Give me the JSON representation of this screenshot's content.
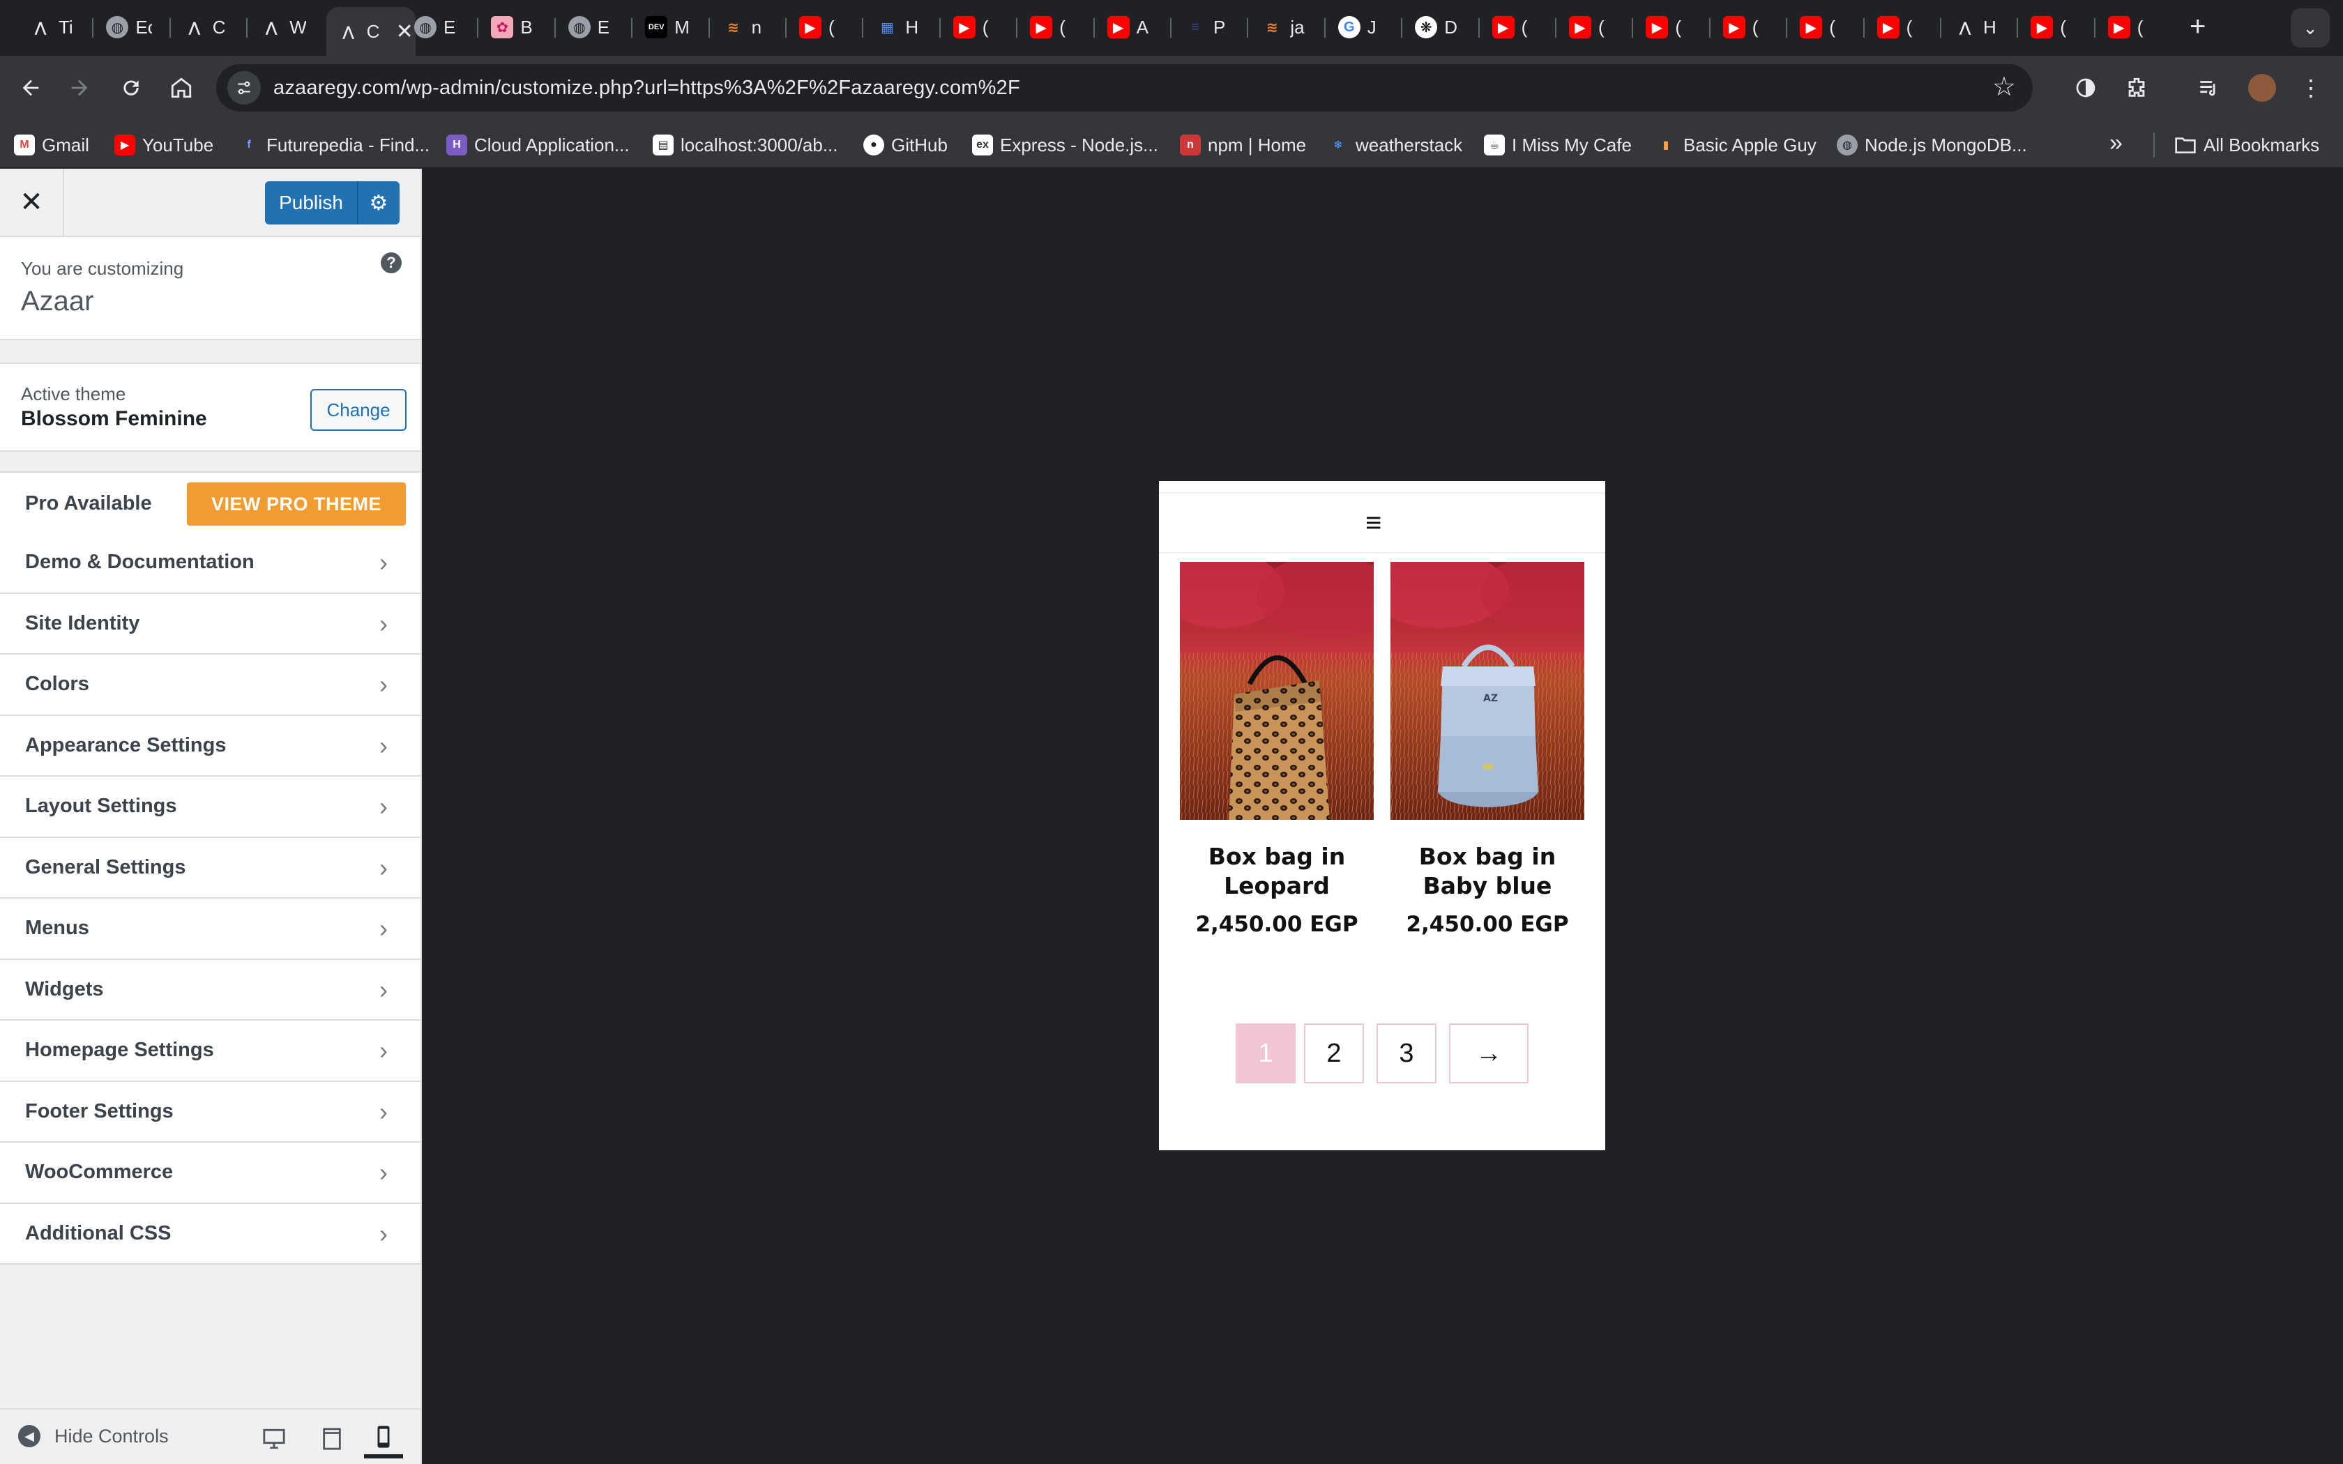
{
  "browser": {
    "tabs": [
      {
        "title": "Ti",
        "icon": "a-logo-icon"
      },
      {
        "title": "Ec",
        "icon": "globe-icon"
      },
      {
        "title": "C",
        "icon": "a-logo-icon"
      },
      {
        "title": "W",
        "icon": "a-logo-icon"
      },
      {
        "title": "C",
        "icon": "a-logo-icon",
        "active": true
      },
      {
        "title": "E",
        "icon": "globe-icon"
      },
      {
        "title": "B",
        "icon": "flower-icon"
      },
      {
        "title": "E",
        "icon": "globe-icon"
      },
      {
        "title": "M",
        "icon": "dev-icon"
      },
      {
        "title": "n",
        "icon": "stack-icon"
      },
      {
        "title": "(",
        "icon": "youtube-icon"
      },
      {
        "title": "H",
        "icon": "grid-icon"
      },
      {
        "title": "(",
        "icon": "youtube-icon"
      },
      {
        "title": "(",
        "icon": "youtube-icon"
      },
      {
        "title": "A",
        "icon": "youtube-icon"
      },
      {
        "title": "P",
        "icon": "lines-icon"
      },
      {
        "title": "ja",
        "icon": "stack-icon"
      },
      {
        "title": "J",
        "icon": "google-icon"
      },
      {
        "title": "D",
        "icon": "openai-icon"
      },
      {
        "title": "(",
        "icon": "youtube-icon"
      },
      {
        "title": "(",
        "icon": "youtube-icon"
      },
      {
        "title": "(",
        "icon": "youtube-icon"
      },
      {
        "title": "(",
        "icon": "youtube-icon"
      },
      {
        "title": "(",
        "icon": "youtube-icon"
      },
      {
        "title": "(",
        "icon": "youtube-icon"
      },
      {
        "title": "H",
        "icon": "a-logo-icon"
      },
      {
        "title": "(",
        "icon": "youtube-icon"
      },
      {
        "title": "(",
        "icon": "youtube-icon"
      }
    ],
    "url": "azaaregy.com/wp-admin/customize.php?url=https%3A%2F%2Fazaaregy.com%2F",
    "bookmarks": [
      {
        "label": "Gmail",
        "icon": "gmail-icon"
      },
      {
        "label": "YouTube",
        "icon": "youtube-icon"
      },
      {
        "label": "Futurepedia - Find...",
        "icon": "futurepedia-icon"
      },
      {
        "label": "Cloud Application...",
        "icon": "heroku-icon"
      },
      {
        "label": "localhost:3000/ab...",
        "icon": "page-icon"
      },
      {
        "label": "GitHub",
        "icon": "github-icon"
      },
      {
        "label": "Express - Node.js...",
        "icon": "express-icon"
      },
      {
        "label": "npm | Home",
        "icon": "npm-icon"
      },
      {
        "label": "weatherstack",
        "icon": "snowflake-icon"
      },
      {
        "label": "I Miss My Cafe",
        "icon": "cafe-icon"
      },
      {
        "label": "Basic Apple Guy",
        "icon": "apple-guy-icon"
      },
      {
        "label": "Node.js MongoDB...",
        "icon": "globe-icon"
      }
    ],
    "all_bookmarks": "All Bookmarks"
  },
  "customizer": {
    "publish_label": "Publish",
    "customizing_label": "You are customizing",
    "site_name": "Azaar",
    "active_theme_label": "Active theme",
    "theme_name": "Blossom Feminine",
    "change_label": "Change",
    "pro_label": "Pro Available",
    "pro_button": "VIEW PRO THEME",
    "sections": [
      "Demo & Documentation",
      "Site Identity",
      "Colors",
      "Appearance Settings",
      "Layout Settings",
      "General Settings",
      "Menus",
      "Widgets",
      "Homepage Settings",
      "Footer Settings",
      "WooCommerce",
      "Additional CSS"
    ],
    "hide_controls": "Hide Controls",
    "active_device": "mobile"
  },
  "preview": {
    "products": [
      {
        "name": "Box bag in Leopard",
        "price": "2,450.00 EGP"
      },
      {
        "name": "Box bag in Baby blue",
        "price": "2,450.00 EGP"
      }
    ],
    "pagination": [
      "1",
      "2",
      "3",
      "→"
    ],
    "current_page": "1"
  },
  "colors": {
    "accent": "#2271b1",
    "pro": "#f19c33",
    "pager_active": "#f2c4d6",
    "browser_bg": "#202124"
  }
}
